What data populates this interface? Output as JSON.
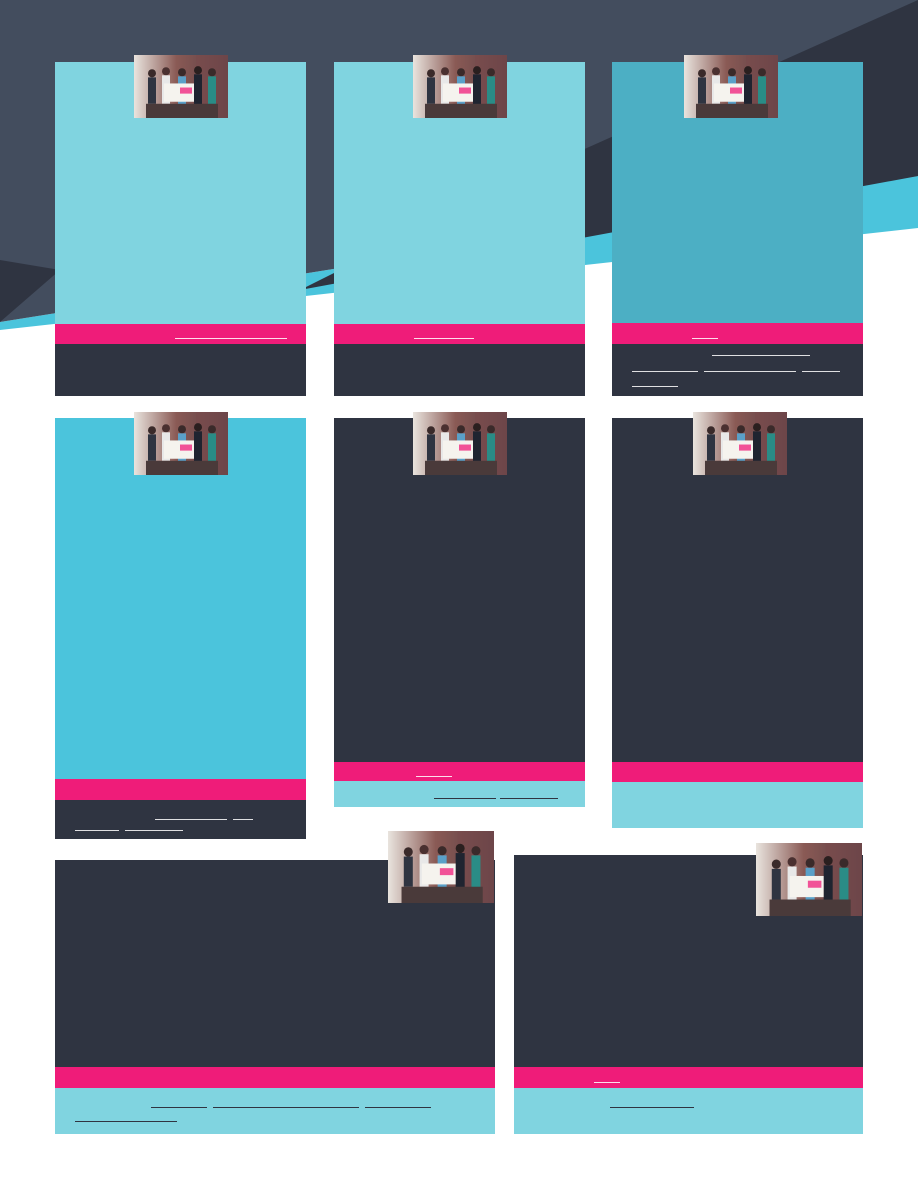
{
  "colors": {
    "navy": "#2f3441",
    "slate": "#434d5e",
    "cyan_light": "#80d4e0",
    "cyan_mid": "#4bc4dc",
    "teal": "#4cafc4",
    "pink": "#ef1c79",
    "white": "#ffffff"
  },
  "cards": [
    {
      "id": "team-1",
      "photo": "group-photo",
      "body_color": "#80d4e0",
      "footer_color": "#2f3441"
    },
    {
      "id": "team-2",
      "photo": "group-photo",
      "body_color": "#80d4e0",
      "footer_color": "#2f3441"
    },
    {
      "id": "team-3",
      "photo": "group-photo",
      "body_color": "#4cafc4",
      "footer_color": "#2f3441"
    },
    {
      "id": "team-4",
      "photo": "group-photo",
      "body_color": "#4bc4dc",
      "footer_color": "#2f3441"
    },
    {
      "id": "team-5",
      "photo": "group-photo",
      "body_color": "#2f3441",
      "footer_color": "#80d4e0"
    },
    {
      "id": "team-6",
      "photo": "group-photo",
      "body_color": "#2f3441",
      "footer_color": "#80d4e0"
    },
    {
      "id": "team-7",
      "photo": "group-photo",
      "body_color": "#2f3441",
      "footer_color": "#80d4e0"
    },
    {
      "id": "team-8",
      "photo": "group-photo",
      "body_color": "#2f3441",
      "footer_color": "#80d4e0"
    }
  ]
}
